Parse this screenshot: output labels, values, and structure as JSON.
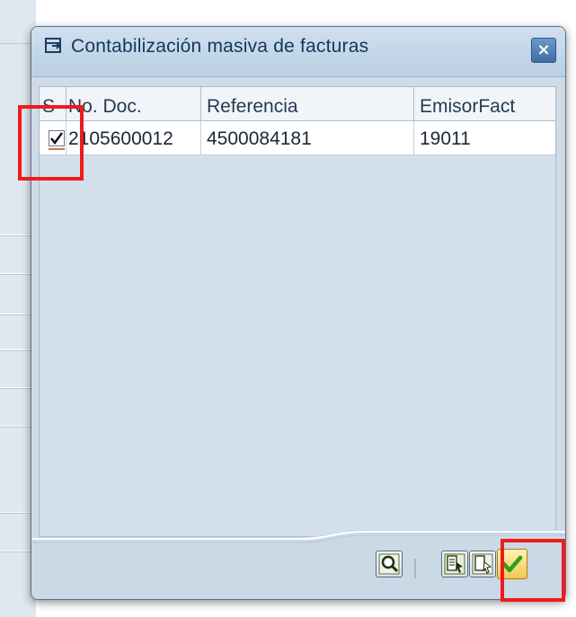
{
  "dialog": {
    "title": "Contabilización masiva de facturas",
    "close_label": "×"
  },
  "table": {
    "columns": [
      "S",
      "No. Doc.",
      "Referencia",
      "EmisorFact"
    ],
    "rows": [
      {
        "selected": true,
        "doc": "2105600012",
        "ref": "4500084181",
        "emisor": "19011"
      }
    ]
  },
  "toolbar": {
    "buttons": [
      {
        "name": "find-button",
        "icon": "magnifier-icon"
      },
      {
        "name": "select-all-button",
        "icon": "select-all-icon"
      },
      {
        "name": "deselect-all-button",
        "icon": "deselect-all-icon"
      },
      {
        "name": "confirm-button",
        "icon": "check-icon"
      }
    ]
  },
  "colors": {
    "highlight": "#ef1b1b",
    "title_text": "#15365e",
    "dialog_bg": "#cfdbe7",
    "confirm_green": "#2f9f1f"
  }
}
